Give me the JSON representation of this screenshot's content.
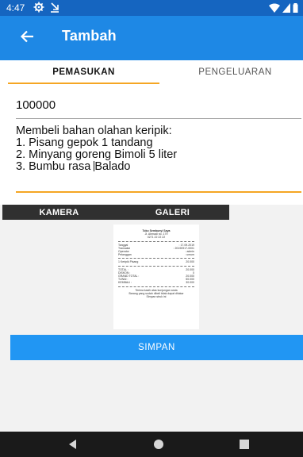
{
  "status_bar": {
    "time": "4:47",
    "icons": [
      "gear-icon",
      "download-icon",
      "wifi-icon",
      "signal-icon",
      "battery-icon"
    ]
  },
  "app_bar": {
    "title": "Tambah",
    "back_icon": "arrow-left-icon"
  },
  "tabs": [
    {
      "label": "PEMASUKAN",
      "active": true
    },
    {
      "label": "PENGELUARAN",
      "active": false
    }
  ],
  "form": {
    "amount": "100000",
    "description_lines": [
      "Membeli bahan olahan keripik:",
      "1. Pisang gepok 1 tandang",
      "2. Minyang goreng Bimoli 5 liter",
      "3. Bumbu rasa Balado"
    ]
  },
  "image_tabs": [
    "KAMERA",
    "GALERI"
  ],
  "receipt": {
    "store": "Toko Sembunyi Saya",
    "address": "Jl. Ahmadi no. 179",
    "phone": "0271 22 22 22",
    "fields": [
      {
        "k": "Tanggal",
        "v": ": 17.09.2019"
      },
      {
        "k": "Transaksi",
        "v": ": 20190917-0001"
      },
      {
        "k": "Operator",
        "v": ": admin"
      },
      {
        "k": "Pelanggan",
        "v": ": umum"
      }
    ],
    "items": [
      {
        "k": "1  Keripik Pisang",
        "v": "20.000"
      }
    ],
    "totals": [
      {
        "k": "TOTAL :",
        "v": "20.000"
      },
      {
        "k": "DISKON :",
        "v": "0"
      },
      {
        "k": "GRAND TOTAL :",
        "v": "20.000"
      },
      {
        "k": "TUNAI :",
        "v": "50.000"
      },
      {
        "k": "KEMBALI :",
        "v": "30.000"
      }
    ],
    "footer1": "Terima kasih atas kunjungan anda",
    "footer2": "Barang yang sudah dibeli tidak dapat ditukar",
    "footer3": "Simpan struk ini"
  },
  "save_button": {
    "label": "SIMPAN"
  },
  "colors": {
    "status_bar": "#1565c0",
    "app_bar": "#1e88e5",
    "accent": "#f5a623",
    "button": "#2196f3",
    "dark_strip": "#303030",
    "nav_bar": "#1a1a1a"
  }
}
